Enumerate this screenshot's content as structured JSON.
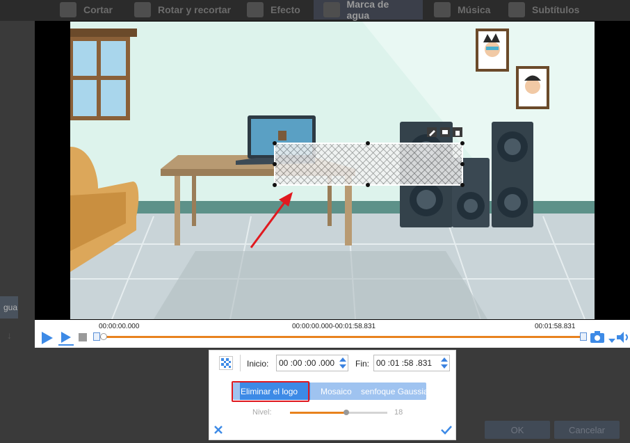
{
  "tabs": [
    {
      "label": "Cortar",
      "icon": "cut-icon"
    },
    {
      "label": "Rotar y recortar",
      "icon": "rotate-crop-icon"
    },
    {
      "label": "Efecto",
      "icon": "effect-icon"
    },
    {
      "label": "Marca de agua",
      "icon": "watermark-icon",
      "active": true
    },
    {
      "label": "Música",
      "icon": "music-icon"
    },
    {
      "label": "Subtítulos",
      "icon": "subtitles-icon"
    }
  ],
  "left_tag": "gua",
  "timeline": {
    "start": "00:00:00.000",
    "range": "00:00:00.000-00:01:58.831",
    "end": "00:01:58.831"
  },
  "panel": {
    "start_label": "Inicio:",
    "start_value": "00 :00 :00 .000",
    "end_label": "Fin:",
    "end_value": "00 :01 :58 .831",
    "modes": [
      "Eliminar el logo",
      "Mosaico",
      "senfoque Gaussia"
    ],
    "active_mode": "Eliminar el logo",
    "level_label": "Nivel:",
    "level_value": "18",
    "level_fraction": 0.58
  },
  "dialog": {
    "ok_label": "OK",
    "cancel_label": "Cancelar"
  },
  "colors": {
    "accent": "#3d8ae6",
    "progress": "#e8821e",
    "highlight": "#e0191f"
  }
}
